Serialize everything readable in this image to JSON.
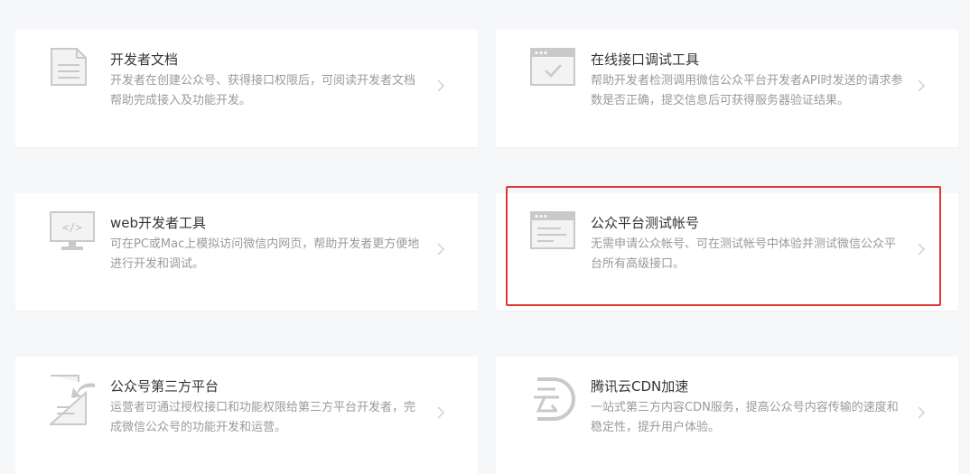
{
  "cards": [
    {
      "icon": "document-icon",
      "title": "开发者文档",
      "desc": "开发者在创建公众号、获得接口权限后，可阅读开发者文档帮助完成接入及功能开发。"
    },
    {
      "icon": "api-debug-window-icon",
      "title": "在线接口调试工具",
      "desc": "帮助开发者检测调用微信公众平台开发者API时发送的请求参数是否正确，提交信息后可获得服务器验证结果。"
    },
    {
      "icon": "web-devtools-monitor-icon",
      "title": "web开发者工具",
      "desc": "可在PC或Mac上模拟访问微信内网页，帮助开发者更方便地进行开发和调试。"
    },
    {
      "icon": "test-account-window-icon",
      "title": "公众平台测试帐号",
      "desc": "无需申请公众帐号、可在测试帐号中体验并测试微信公众平台所有高级接口。"
    },
    {
      "icon": "third-party-platform-icon",
      "title": "公众号第三方平台",
      "desc": "运营者可通过授权接口和功能权限给第三方平台开发者，完成微信公众号的功能开发和运营。"
    },
    {
      "icon": "tencent-cloud-cdn-icon",
      "title": "腾讯云CDN加速",
      "desc": "一站式第三方内容CDN服务，提高公众号内容传输的速度和稳定性，提升用户体验。"
    }
  ],
  "highlight": {
    "color": "#e23636"
  }
}
